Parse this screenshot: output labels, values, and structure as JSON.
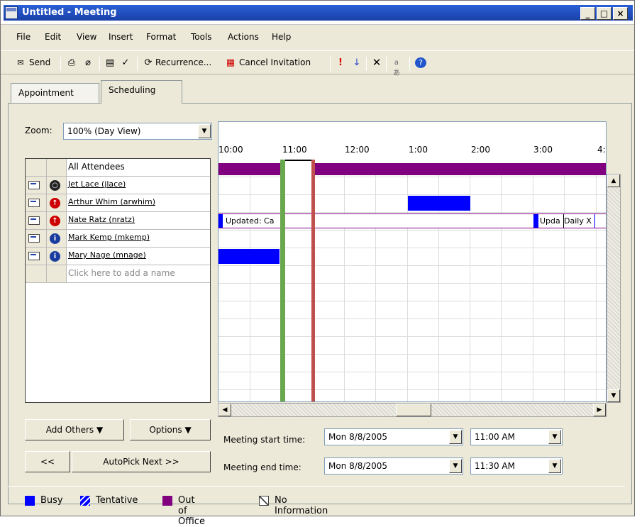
{
  "window": {
    "title": "Untitled - Meeting"
  },
  "menu": [
    "File",
    "Edit",
    "View",
    "Insert",
    "Format",
    "Tools",
    "Actions",
    "Help"
  ],
  "toolbar": {
    "send": "Send",
    "recurrence": "Recurrence...",
    "cancel_invitation": "Cancel Invitation"
  },
  "tabs": {
    "appointment": "Appointment",
    "scheduling": "Scheduling"
  },
  "zoom": {
    "label": "Zoom:",
    "value": "100% (Day View)"
  },
  "attendees": {
    "header": "All Attendees",
    "rows": [
      "Jet Lace (jlace)",
      "Arthur Whim (arwhim)",
      "Nate Ratz (nratz)",
      "Mark Kemp (mkemp)",
      "Mary Nage (mnage)"
    ],
    "add": "Click here to add a name"
  },
  "times": [
    "10:00",
    "11:00",
    "12:00",
    "1:00",
    "2:00",
    "3:00",
    "4:"
  ],
  "grid_text": {
    "updated_1": "Updated: Ca",
    "updated_2": "Upda",
    "daily": "Daily X"
  },
  "buttons": {
    "add_others": "Add Others",
    "options": "Options",
    "prev": "<<",
    "autopick": "AutoPick Next >>"
  },
  "meeting": {
    "start_label": "Meeting start time:",
    "end_label": "Meeting end time:",
    "start_date": "Mon 8/8/2005",
    "start_time": "11:00 AM",
    "end_date": "Mon 8/8/2005",
    "end_time": "11:30 AM"
  },
  "legend": {
    "busy": "Busy",
    "tentative": "Tentative",
    "ooo": "Out of Office",
    "noinfo": "No Information"
  },
  "colors": {
    "busy": "#0000ff",
    "ooo": "#800080",
    "start_line": "#6aa84f",
    "end_line": "#c0504d"
  }
}
